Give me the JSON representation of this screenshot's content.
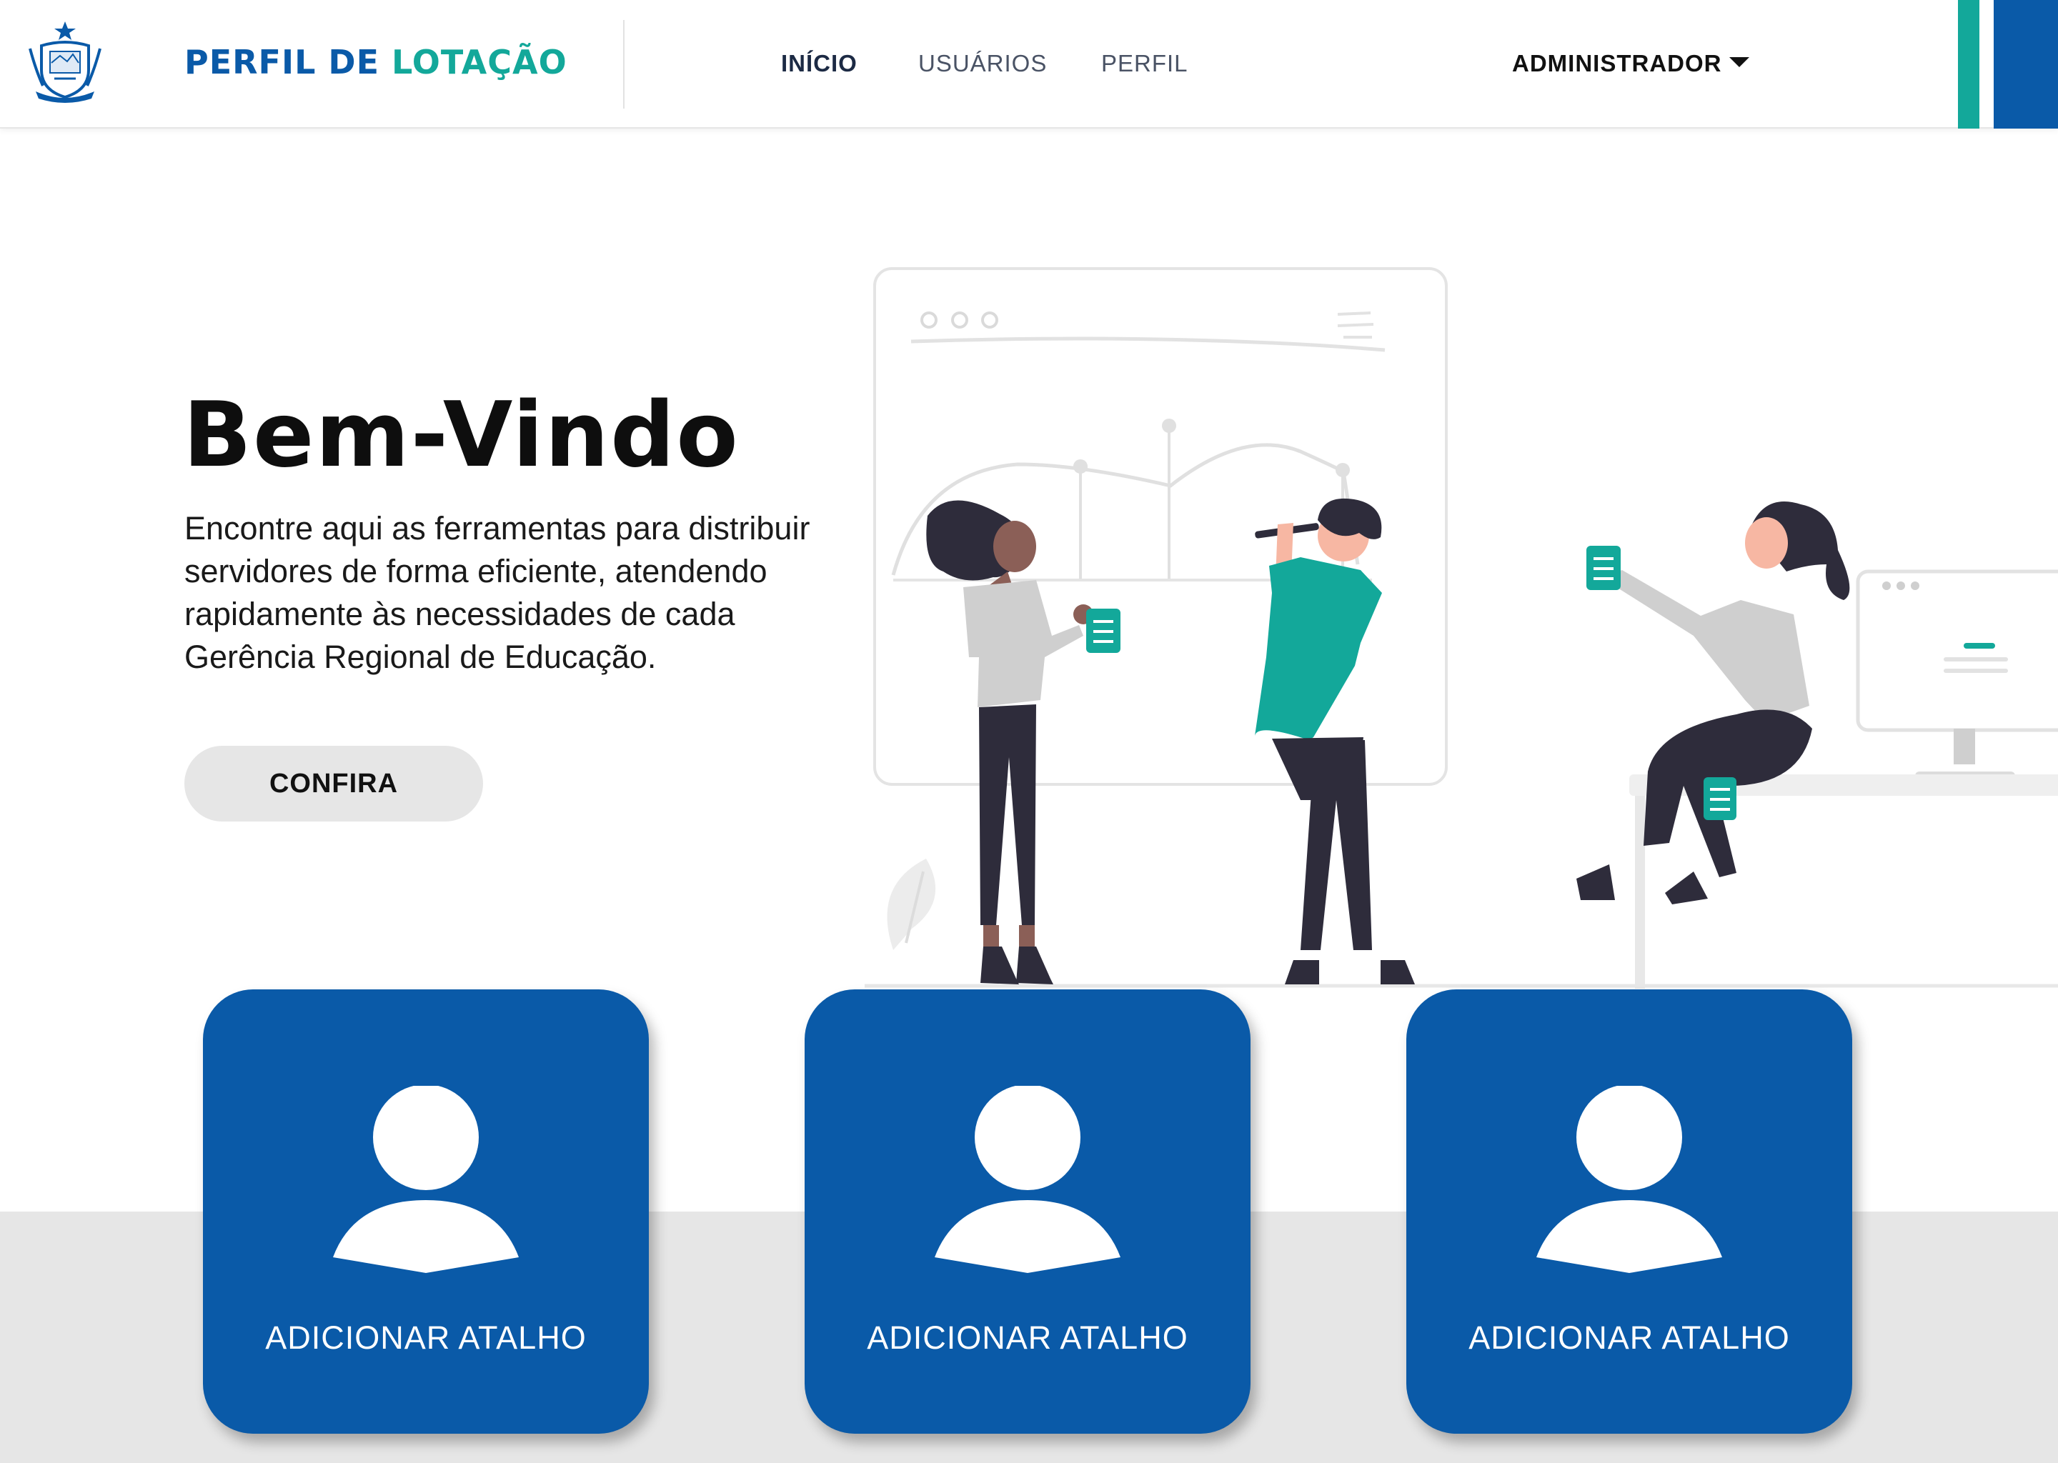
{
  "header": {
    "brand_part1": "PERFIL DE",
    "brand_part2": "LOTAÇÃO",
    "nav": [
      {
        "label": "INÍCIO",
        "active": true
      },
      {
        "label": "USUÁRIOS",
        "active": false
      },
      {
        "label": "PERFIL",
        "active": false
      }
    ],
    "user_menu_label": "ADMINISTRADOR",
    "user_menu_icon": "caret-down-icon"
  },
  "hero": {
    "title": "Bem-Vindo",
    "text": "Encontre aqui as ferramentas para distribuir servidores de forma eficiente, atendendo rapidamente às necessidades de cada Gerência Regional de Educação.",
    "cta_label": "CONFIRA"
  },
  "shortcuts": [
    {
      "label": "ADICIONAR ATALHO",
      "icon": "user-icon"
    },
    {
      "label": "ADICIONAR ATALHO",
      "icon": "user-icon"
    },
    {
      "label": "ADICIONAR ATALHO",
      "icon": "user-icon"
    }
  ],
  "colors": {
    "primary_blue": "#0a5aa8",
    "teal": "#13a89a",
    "light_gray": "#e6e6e6",
    "dark_text": "#0e0e0e"
  }
}
